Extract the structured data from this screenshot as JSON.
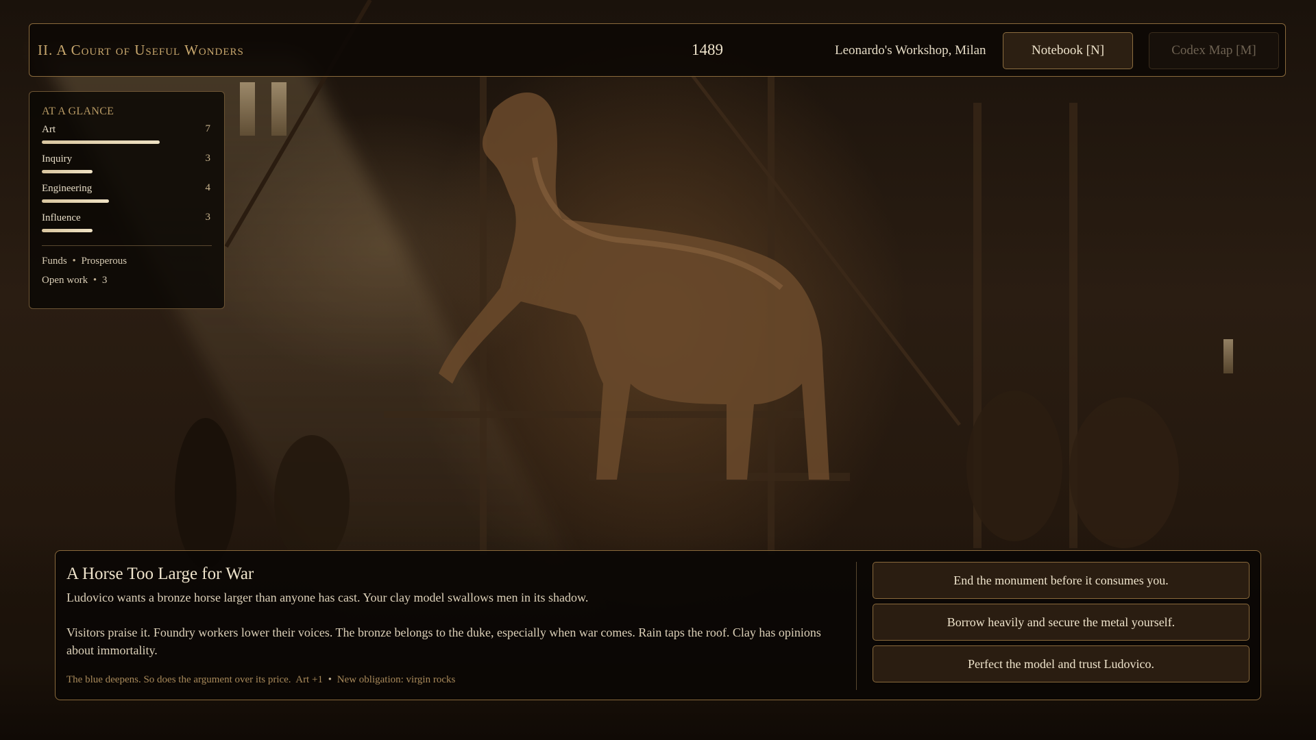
{
  "header": {
    "chapter_title": "II. A Court of Useful Wonders",
    "year": "1489",
    "location": "Leonardo's Workshop, Milan",
    "notebook_button": "Notebook  [N]",
    "codex_map_button": "Codex Map  [M]"
  },
  "glance": {
    "title": "AT A GLANCE",
    "stats": [
      {
        "label": "Art",
        "value": "7",
        "fill_fraction": 0.7
      },
      {
        "label": "Inquiry",
        "value": "3",
        "fill_fraction": 0.3
      },
      {
        "label": "Engineering",
        "value": "4",
        "fill_fraction": 0.4
      },
      {
        "label": "Influence",
        "value": "3",
        "fill_fraction": 0.3
      }
    ],
    "funds_label": "Funds",
    "funds_value": "Prosperous",
    "open_work_label": "Open work",
    "open_work_value": "3",
    "separator": "•"
  },
  "event": {
    "title": "A Horse Too Large for War",
    "intro": "Ludovico wants a bronze horse larger than anyone has cast. Your clay model swallows men in its shadow.",
    "body": "Visitors praise it. Foundry workers lower their voices. The bronze belongs to the duke, especially when war comes. Rain taps the roof. Clay has opinions about immortality.",
    "footer_text": "The blue deepens. So does the argument over its price.",
    "footer_effect": "Art +1",
    "footer_separator": "•",
    "footer_obligation": "New obligation: virgin rocks"
  },
  "choices": [
    {
      "label": "End the monument before it consumes you."
    },
    {
      "label": "Borrow heavily and secure the metal yourself."
    },
    {
      "label": "Perfect the model and trust Ludovico."
    }
  ],
  "colors": {
    "accent": "#8a6a3c",
    "gold_text": "#c9a86e",
    "bar": "#e6d6b2"
  }
}
